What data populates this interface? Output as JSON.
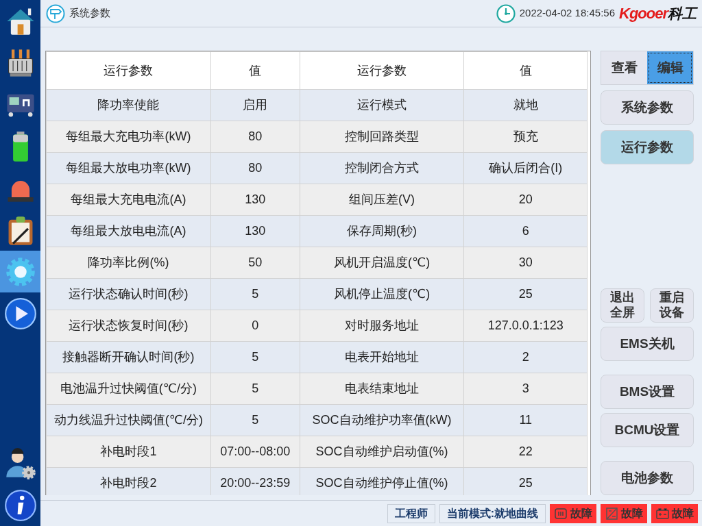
{
  "sidebar": {
    "items": [
      {
        "kind": "home",
        "selected": false
      },
      {
        "kind": "transformer",
        "selected": false
      },
      {
        "kind": "converter",
        "selected": false
      },
      {
        "kind": "battery",
        "selected": false
      },
      {
        "kind": "alarm",
        "selected": false
      },
      {
        "kind": "clipboard",
        "selected": false
      },
      {
        "kind": "gear",
        "selected": true
      },
      {
        "kind": "play",
        "selected": false
      }
    ],
    "bottom_items": [
      {
        "kind": "user",
        "selected": false
      },
      {
        "kind": "info",
        "selected": false
      }
    ]
  },
  "header": {
    "title": "系统参数",
    "datetime": "2022-04-02 18:45:56",
    "logo_latin": "Kgooer",
    "logo_cn": "科工"
  },
  "table": {
    "columns": [
      "运行参数",
      "值",
      "运行参数",
      "值"
    ],
    "rows": [
      [
        "降功率使能",
        "启用",
        "运行模式",
        "就地"
      ],
      [
        "每组最大充电功率(kW)",
        "80",
        "控制回路类型",
        "预充"
      ],
      [
        "每组最大放电功率(kW)",
        "80",
        "控制闭合方式",
        "确认后闭合(I)"
      ],
      [
        "每组最大充电电流(A)",
        "130",
        "组间压差(V)",
        "20"
      ],
      [
        "每组最大放电电流(A)",
        "130",
        "保存周期(秒)",
        "6"
      ],
      [
        "降功率比例(%)",
        "50",
        "风机开启温度(℃)",
        "30"
      ],
      [
        "运行状态确认时间(秒)",
        "5",
        "风机停止温度(℃)",
        "25"
      ],
      [
        "运行状态恢复时间(秒)",
        "0",
        "对时服务地址",
        "127.0.0.1:123"
      ],
      [
        "接触器断开确认时间(秒)",
        "5",
        "电表开始地址",
        "2"
      ],
      [
        "电池温升过快阈值(℃/分)",
        "5",
        "电表结束地址",
        "3"
      ],
      [
        "动力线温升过快阈值(℃/分)",
        "5",
        "SOC自动维护功率值(kW)",
        "11"
      ],
      [
        "补电时段1",
        "07:00--08:00",
        "SOC自动维护启动值(%)",
        "22"
      ],
      [
        "补电时段2",
        "20:00--23:59",
        "SOC自动维护停止值(%)",
        "25"
      ]
    ]
  },
  "mode_tabs": [
    {
      "label": "查看",
      "selected": false
    },
    {
      "label": "编辑",
      "selected": true
    }
  ],
  "nav_buttons": [
    {
      "label": "系统参数",
      "selected": false
    },
    {
      "label": "运行参数",
      "selected": true
    }
  ],
  "small_buttons": [
    {
      "lines": [
        "退出",
        "全屏"
      ]
    },
    {
      "lines": [
        "重启",
        "设备"
      ]
    }
  ],
  "action_buttons": [
    {
      "label": "EMS关机"
    },
    {
      "label": "BMS设置"
    },
    {
      "label": "BCMU设置"
    },
    {
      "label": "电池参数"
    }
  ],
  "status_bar": {
    "user": "工程师",
    "mode": "当前模式:就地曲线",
    "faults": [
      {
        "kind": "pcs",
        "label": "故障"
      },
      {
        "kind": "dcdc",
        "label": "故障"
      },
      {
        "kind": "battery",
        "label": "故障"
      }
    ]
  }
}
